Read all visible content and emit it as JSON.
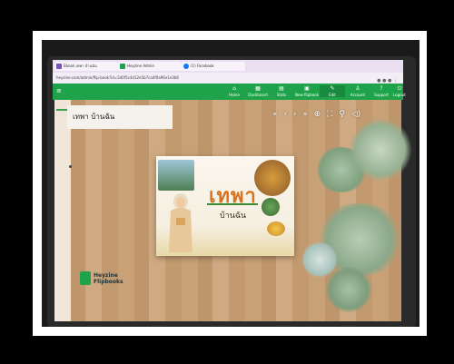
{
  "browser": {
    "tabs": [
      {
        "label": "Ebook เทพา บ้านฉัน",
        "color": "#7a4fbf"
      },
      {
        "label": "Heyzine Admin",
        "color": "#1fa34a"
      },
      {
        "label": "(1) Facebook",
        "color": "#1877f2"
      }
    ],
    "address": "heyzine.com/admin/flip-book?id=5d0f5c4d12e5b7ca4f0a96e1e3b6"
  },
  "appbar": {
    "items": [
      {
        "label": "Home",
        "icon": "home-icon"
      },
      {
        "label": "Dashboard",
        "icon": "dashboard-icon"
      },
      {
        "label": "Stats",
        "icon": "stats-icon"
      },
      {
        "label": "New flipbook",
        "icon": "new-flipbook-icon"
      },
      {
        "label": "Edit",
        "icon": "edit-icon"
      },
      {
        "label": "Account",
        "icon": "account-icon"
      },
      {
        "label": "Support",
        "icon": "support-icon"
      },
      {
        "label": "Logout",
        "icon": "logout-icon"
      }
    ]
  },
  "flipbook": {
    "title": "เทพา บ้านฉัน",
    "cover_title": "เทพา",
    "cover_subtitle": "บ้านฉัน"
  },
  "viewer_toolbar": [
    "«",
    "‹",
    "›",
    "»",
    "⊕",
    "⛶",
    "⚲",
    "◁)"
  ],
  "logo": {
    "line1": "Heyzine",
    "line2": "Flipbooks"
  },
  "colors": {
    "accent": "#1fa34a",
    "cover_title": "#d9731f"
  }
}
